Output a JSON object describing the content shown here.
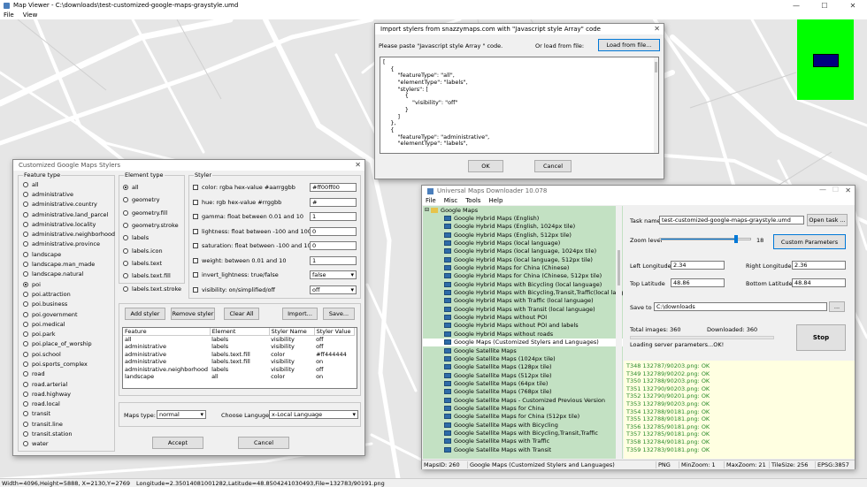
{
  "main": {
    "title": "Map Viewer - C:\\downloads\\test-customized-google-maps-graystyle.umd",
    "menu": [
      "File",
      "View"
    ],
    "win_buttons": [
      "—",
      "☐",
      "✕"
    ],
    "status": {
      "dims": "Width=4096,Height=5888, X=2130,Y=2769",
      "coords": "Longitude=2.35014081001282,Latitude=48.8504241030493,File=132783/90191.png"
    }
  },
  "styler": {
    "title": "Customized Google Maps Stylers",
    "feature_type_label": "Feature type",
    "feature_types": [
      "all",
      "administrative",
      "administrative.country",
      "administrative.land_parcel",
      "administrative.locality",
      "administrative.neighborhood",
      "administrative.province",
      "landscape",
      "landscape.man_made",
      "landscape.natural",
      "poi",
      "poi.attraction",
      "poi.business",
      "poi.government",
      "poi.medical",
      "poi.park",
      "poi.place_of_worship",
      "poi.school",
      "poi.sports_complex",
      "road",
      "road.arterial",
      "road.highway",
      "road.local",
      "transit",
      "transit.line",
      "transit.station",
      "water"
    ],
    "feature_selected_index": 10,
    "element_type_label": "Element type",
    "element_types": [
      "all",
      "geometry",
      "geometry.fill",
      "geometry.stroke",
      "labels",
      "labels.icon",
      "labels.text",
      "labels.text.fill",
      "labels.text.stroke"
    ],
    "element_selected_index": 0,
    "styler_label": "Styler",
    "stylers": [
      {
        "label": "color: rgba hex-value #aarrggbb",
        "value": "#ff00ff00"
      },
      {
        "label": "hue: rgb hex-value #rrggbb",
        "value": "#"
      },
      {
        "label": "gamma: float between 0.01 and 10",
        "value": "1"
      },
      {
        "label": "lightness: float between -100 and 100",
        "value": "0"
      },
      {
        "label": "saturation: float between -100 and 100",
        "value": "0"
      },
      {
        "label": "weight: between 0.01 and  10",
        "value": "1"
      },
      {
        "label": "invert_lightness: true/false",
        "value": "false"
      },
      {
        "label": "visibility: on/simplified/off",
        "value": "off"
      }
    ],
    "buttons": {
      "add": "Add styler",
      "remove": "Remove styler",
      "clear": "Clear All",
      "import": "Import...",
      "save": "Save..."
    },
    "table": {
      "headers": [
        "Feature",
        "Element",
        "Styler Name",
        "Styler Value"
      ],
      "rows": [
        [
          "all",
          "labels",
          "visibility",
          "off"
        ],
        [
          "administrative",
          "labels",
          "visibility",
          "off"
        ],
        [
          "administrative",
          "labels.text.fill",
          "color",
          "#ff444444"
        ],
        [
          "administrative",
          "labels.text.fill",
          "visibility",
          "on"
        ],
        [
          "administrative.neighborhood",
          "labels",
          "visibility",
          "off"
        ],
        [
          "landscape",
          "all",
          "color",
          "on"
        ]
      ]
    },
    "maps_type_label": "Maps type:",
    "maps_type_value": "normal",
    "language_label": "Choose Languge:",
    "language_value": "x-Local Language",
    "accept": "Accept",
    "cancel": "Cancel"
  },
  "import": {
    "title": "Import stylers from snazzymaps.com with \"Javascript style Array\" code",
    "paste_label": "Please paste \"Javascript style Array \" code.",
    "load_label": "Or load from file:",
    "load_button": "Load from file...",
    "code_lines": [
      "[",
      "    {",
      "        \"featureType\": \"all\",",
      "        \"elementType\": \"labels\",",
      "        \"stylers\": [",
      "            {",
      "                \"visibility\": \"off\"",
      "            }",
      "        ]",
      "    },",
      "    {",
      "        \"featureType\": \"administrative\",",
      "        \"elementType\": \"labels\","
    ],
    "ok": "OK",
    "cancel": "Cancel"
  },
  "downloader": {
    "title": "Universal Maps Downloader 10.078",
    "menu": [
      "File",
      "Misc",
      "Tools",
      "Help"
    ],
    "tree_root": "Google Maps",
    "tree_items": [
      "Google Hybrid Maps (English)",
      "Google Hybrid Maps (English, 1024px tile)",
      "Google Hybrid Maps (English, 512px tile)",
      "Google Hybrid Maps (local language)",
      "Google Hybrid Maps (local language, 1024px tile)",
      "Google Hybrid Maps (local language, 512px tile)",
      "Google Hybrid Maps for China (Chinese)",
      "Google Hybrid Maps for China (Chinese, 512px tile)",
      "Google Hybrid Maps with Bicycling (local language)",
      "Google Hybrid Maps with Bicycling,Transit,Traffic(local language",
      "Google Hybrid Maps with Traffic (local language)",
      "Google Hybrid Maps with Transit (local language)",
      "Google Hybrid Maps without POI",
      "Google Hybrid Maps without POI and labels",
      "Google Hybrid Maps without roads",
      "Google Maps (Customized Stylers and Languages)",
      "Google Satellite Maps",
      "Google Satellite Maps (1024px tile)",
      "Google Satellite Maps (128px tile)",
      "Google Satellite Maps (512px tile)",
      "Google Satellite Maps (64px tile)",
      "Google Satellite Maps (768px tile)",
      "Google Satellite Maps - Customized Previous Version",
      "Google Satellite Maps for China",
      "Google Satellite Maps for China (512px tile)",
      "Google Satellite Maps with Bicycling",
      "Google Satellite Maps with Bicycling,Transit,Traffic",
      "Google Satellite Maps with Traffic",
      "Google Satellite Maps with Transit"
    ],
    "tree_selected_index": 15,
    "task_name_label": "Task name",
    "task_name_value": "test-customized-google-maps-graystyle.umd",
    "open_task": "Open task ...",
    "zoom_label": "Zoom level",
    "zoom_value": "18",
    "zoom_fraction": 0.85,
    "custom_params": "Custom Parameters",
    "left_lon_label": "Left Longitude",
    "left_lon_value": "2.34",
    "right_lon_label": "Right Longitude",
    "right_lon_value": "2.36",
    "top_lat_label": "Top Latitude",
    "top_lat_value": "48.86",
    "bottom_lat_label": "Bottom Latitude",
    "bottom_lat_value": "48.84",
    "save_to_label": "Save to",
    "save_to_value": "C:\\downloads",
    "browse": "...",
    "total_images": "Total images: 360",
    "downloaded": "Downloaded: 360",
    "status_msg": "Loading server parameters...OK!",
    "stop": "Stop",
    "log_lines": [
      "T348 132787/90203.png: OK",
      "T349 132789/90202.png: OK",
      "T350 132788/90203.png: OK",
      "T351 132790/90203.png: OK",
      "T352 132790/90201.png: OK",
      "T353 132789/90203.png: OK",
      "T354 132788/90181.png: OK",
      "T355 132788/90181.png: OK",
      "T356 132785/90181.png: OK",
      "T357 132785/90181.png: OK",
      "T358 132784/90181.png: OK",
      "T359 132783/90181.png: OK"
    ],
    "status": {
      "maps_id": "MapsID: 260",
      "map_name": "Google Maps (Customized Stylers and Languages)",
      "format": "PNG",
      "minzoom": "MinZoom: 1",
      "maxzoom": "MaxZoom: 21",
      "tilesize": "TileSize: 256",
      "epsg": "EPSG:3857"
    }
  },
  "colors": {
    "minimap_bg": "#00ff00",
    "minimap_box": "#000080",
    "tree_bg": "#c3e1c3",
    "log_bg": "#ffffe1",
    "log_text": "#2a8a2a"
  }
}
